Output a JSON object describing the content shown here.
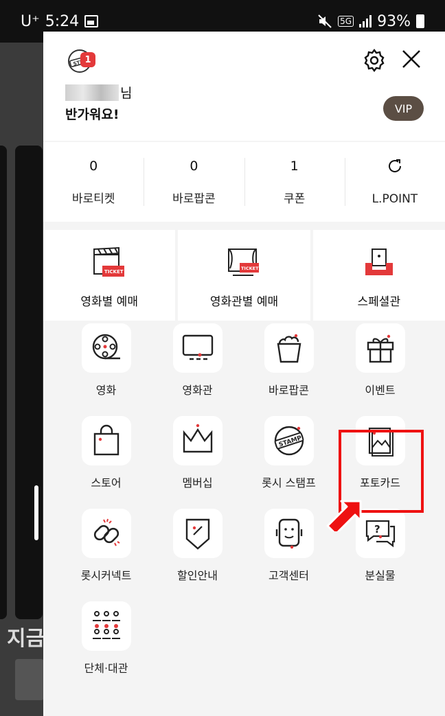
{
  "status_bar": {
    "carrier": "U⁺",
    "time": "5:24",
    "network": "5G",
    "battery": "93%"
  },
  "profile": {
    "name_suffix": "님",
    "greeting": "반가워요!",
    "notification_count": "1",
    "tier": "VIP"
  },
  "stats": [
    {
      "value": "0",
      "label": "바로티켓"
    },
    {
      "value": "0",
      "label": "바로팝콘"
    },
    {
      "value": "1",
      "label": "쿠폰"
    },
    {
      "value": "",
      "label": "L.POINT"
    }
  ],
  "booking": [
    {
      "label": "영화별 예매"
    },
    {
      "label": "영화관별 예매"
    },
    {
      "label": "스페셜관"
    }
  ],
  "menu": [
    {
      "label": "영화"
    },
    {
      "label": "영화관"
    },
    {
      "label": "바로팝콘"
    },
    {
      "label": "이벤트"
    },
    {
      "label": "스토어"
    },
    {
      "label": "멤버십"
    },
    {
      "label": "롯시 스탬프"
    },
    {
      "label": "포토카드"
    },
    {
      "label": "롯시커넥트"
    },
    {
      "label": "할인안내"
    },
    {
      "label": "고객센터"
    },
    {
      "label": "분실물"
    },
    {
      "label": "단체·대관"
    }
  ],
  "background": {
    "partial_heading": "지금"
  },
  "colors": {
    "accent": "#e3393a",
    "vip": "#5b4e44",
    "highlight": "#e11111"
  }
}
